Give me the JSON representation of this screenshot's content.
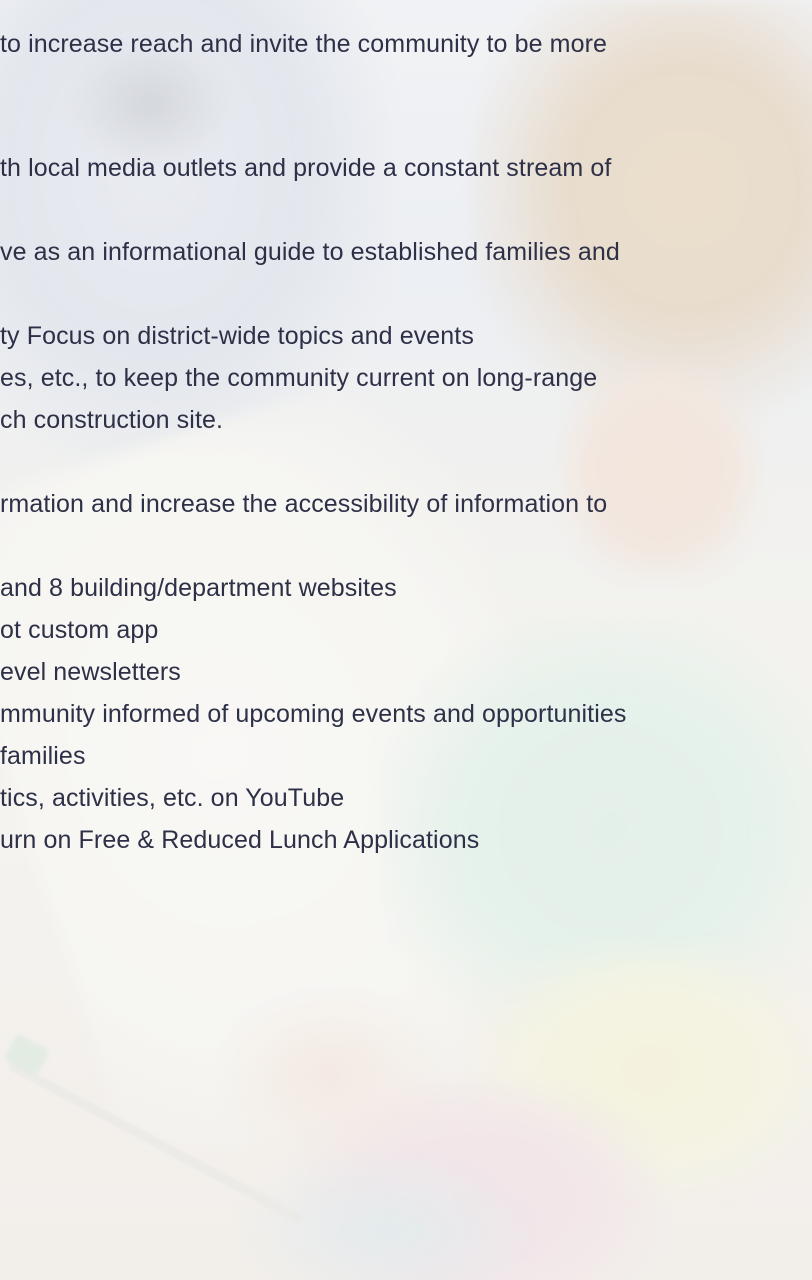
{
  "text_lines": [
    "to increase reach and invite the community to be more",
    "th local media outlets and provide a constant stream of",
    "ve as an informational guide to established families and",
    "ty Focus on district-wide topics and events",
    "es, etc., to keep the community current on long-range",
    "ch construction site.",
    "rmation and increase the accessibility of information to",
    "and 8 building/department websites",
    "ot custom app",
    "evel newsletters",
    "mmunity informed of upcoming events and opportunities",
    "families",
    "tics, activities, etc. on YouTube",
    "urn on Free & Reduced Lunch Applications"
  ],
  "colors": {
    "text": "#2d3047"
  }
}
